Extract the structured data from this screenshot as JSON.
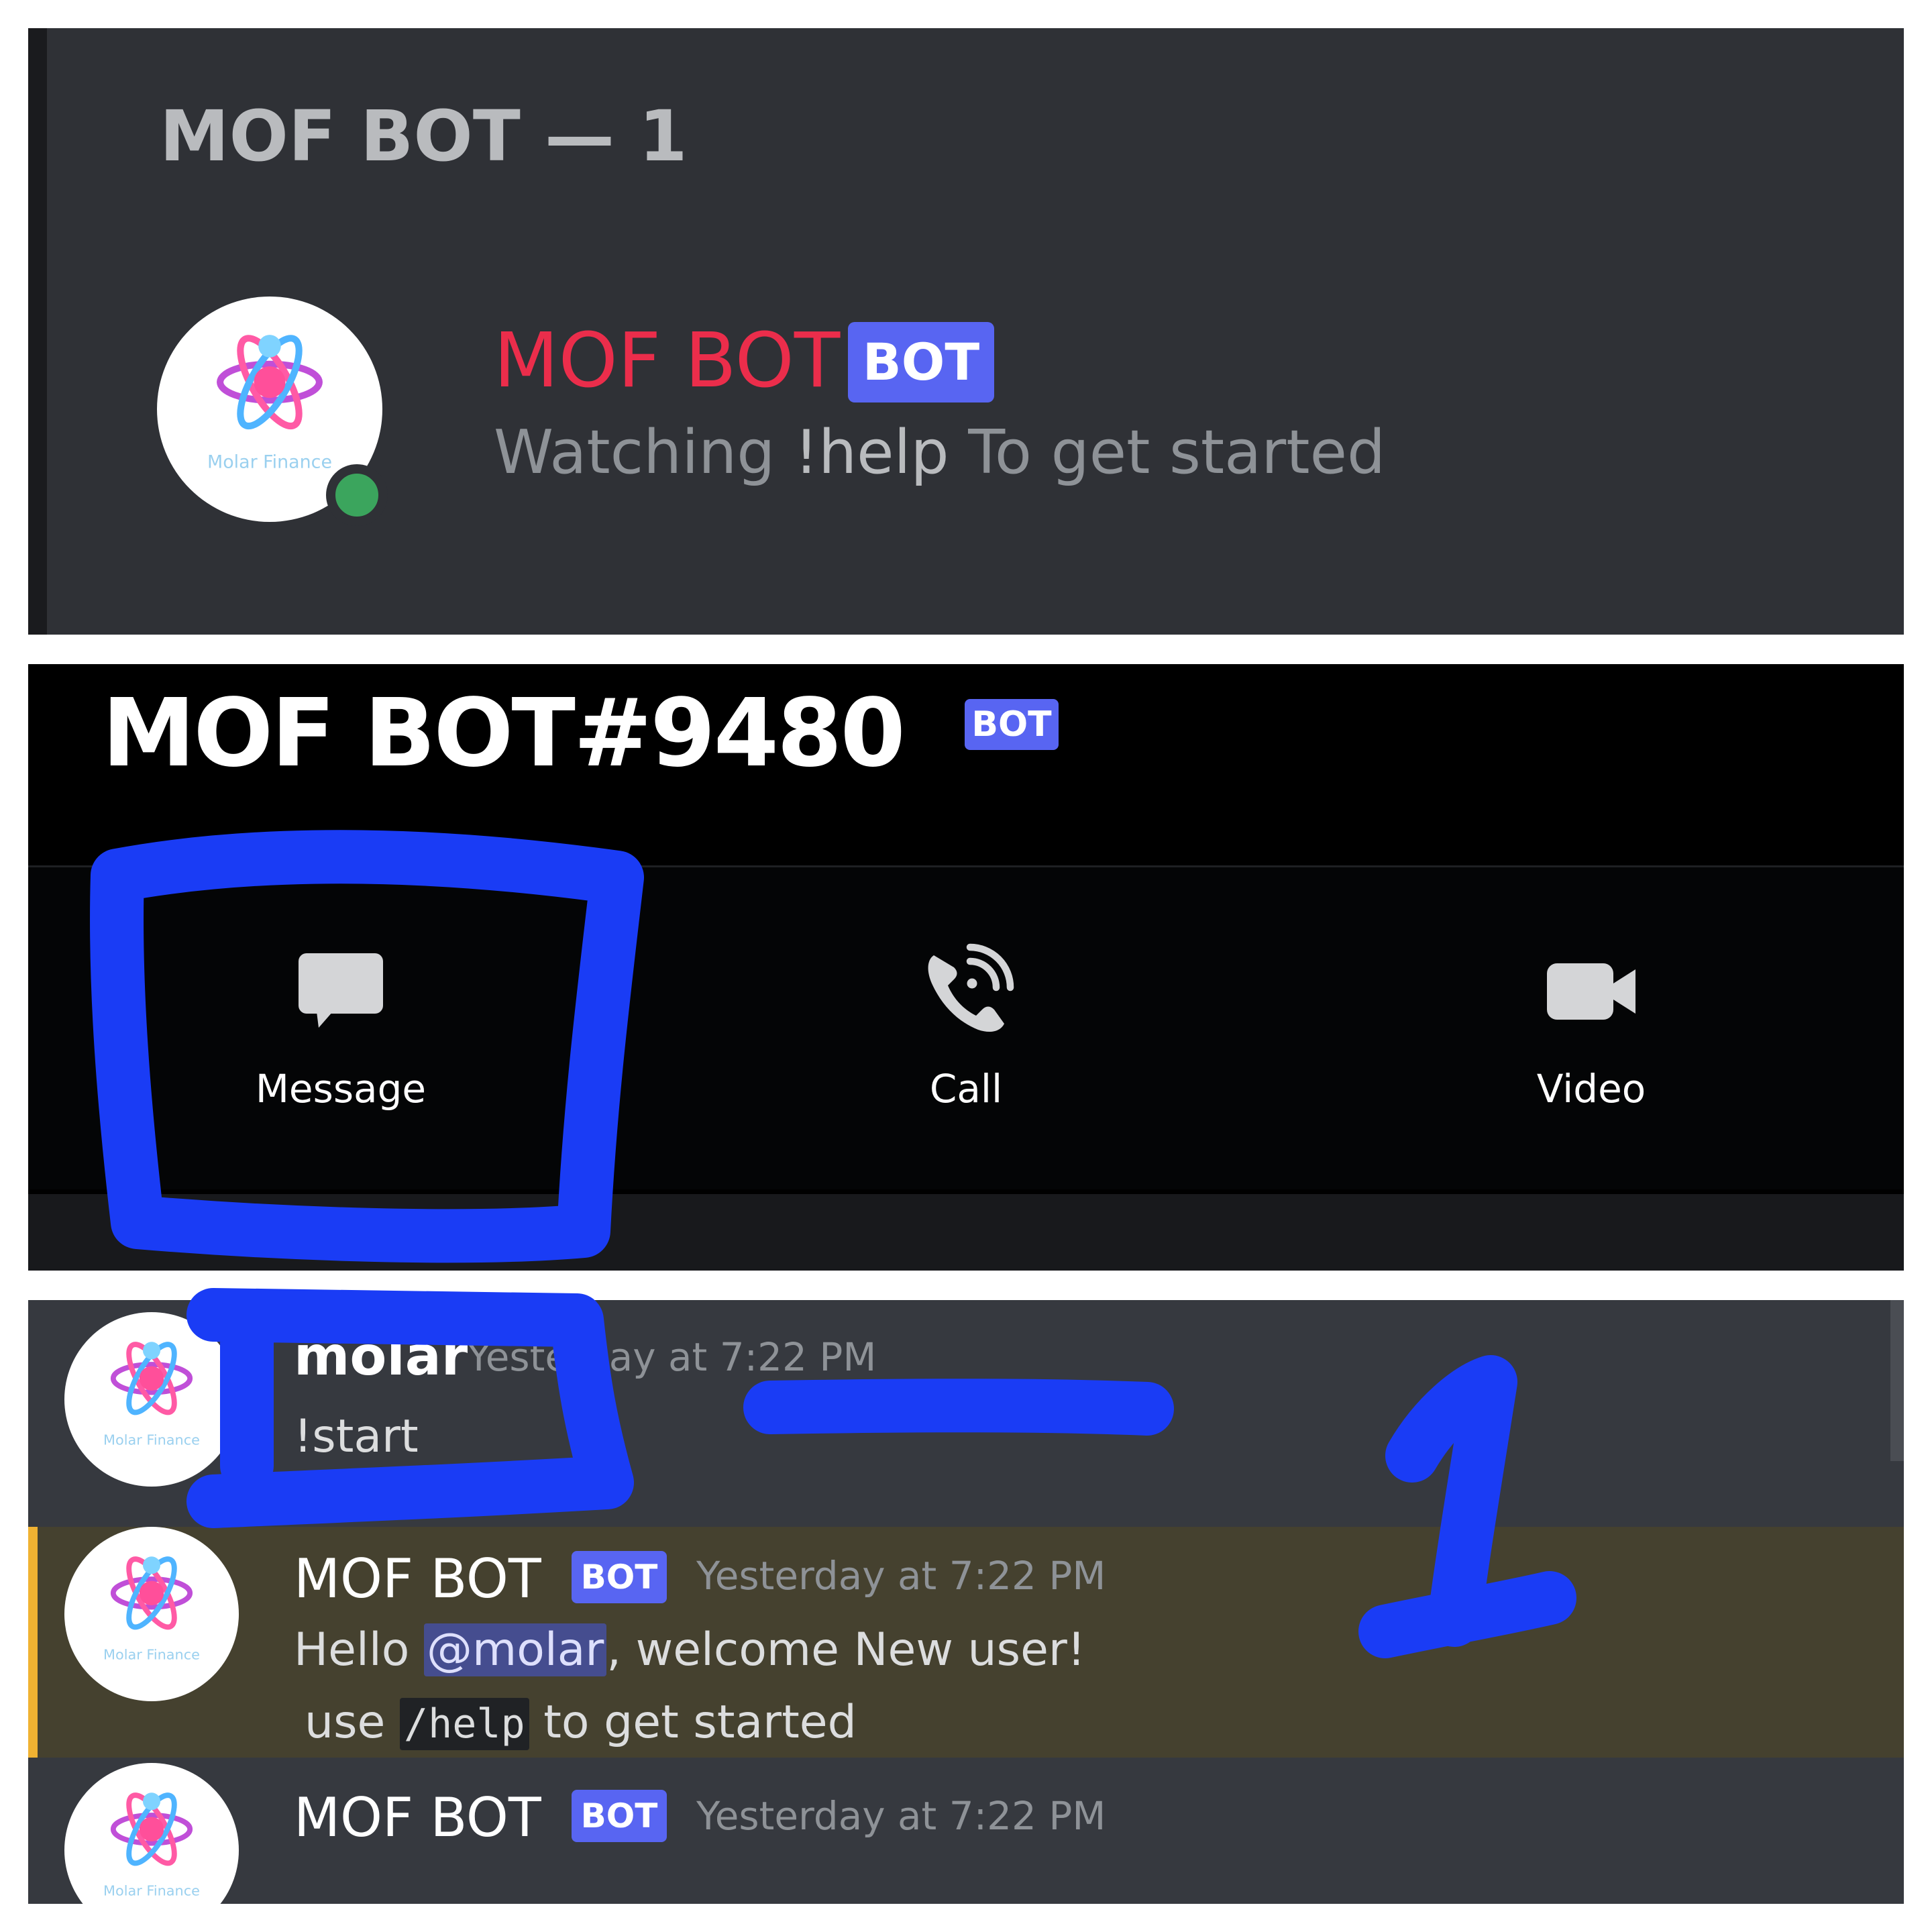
{
  "members_panel": {
    "header": "MOF BOT — 1",
    "member": {
      "name": "MOF BOT",
      "tag": "BOT",
      "status_prefix": "Watching",
      "status_highlight": "!help",
      "status_suffix": "To get started",
      "avatar_text": "Molar Finance",
      "presence": "online"
    }
  },
  "profile_panel": {
    "username": "MOF BOT#9480",
    "tag": "BOT",
    "actions": [
      {
        "label": "Message",
        "icon": "message-icon"
      },
      {
        "label": "Call",
        "icon": "phone-icon"
      },
      {
        "label": "Video",
        "icon": "video-camera-icon"
      }
    ]
  },
  "chat": {
    "messages": [
      {
        "author": "molar",
        "timestamp": "Yesterday at 7:22 PM",
        "content": "!start"
      },
      {
        "author": "MOF BOT",
        "tag": "BOT",
        "timestamp": "Yesterday at 7:22 PM",
        "line1_prefix": "Hello",
        "mention": "@molar",
        "line1_suffix": ", welcome New user!",
        "line2_prefix": "use",
        "code": "/help",
        "line2_suffix": "to get started"
      },
      {
        "author": "MOF BOT",
        "tag": "BOT",
        "timestamp": "Yesterday at 7:22 PM"
      }
    ]
  },
  "colors": {
    "blurple": "#5865f2",
    "bot_name_red": "#eb2d4b",
    "online_green": "#3ba55d",
    "mention_highlight": "#45412f",
    "annotation_blue": "#1a3cf5"
  },
  "annotation": {
    "label": "1"
  }
}
